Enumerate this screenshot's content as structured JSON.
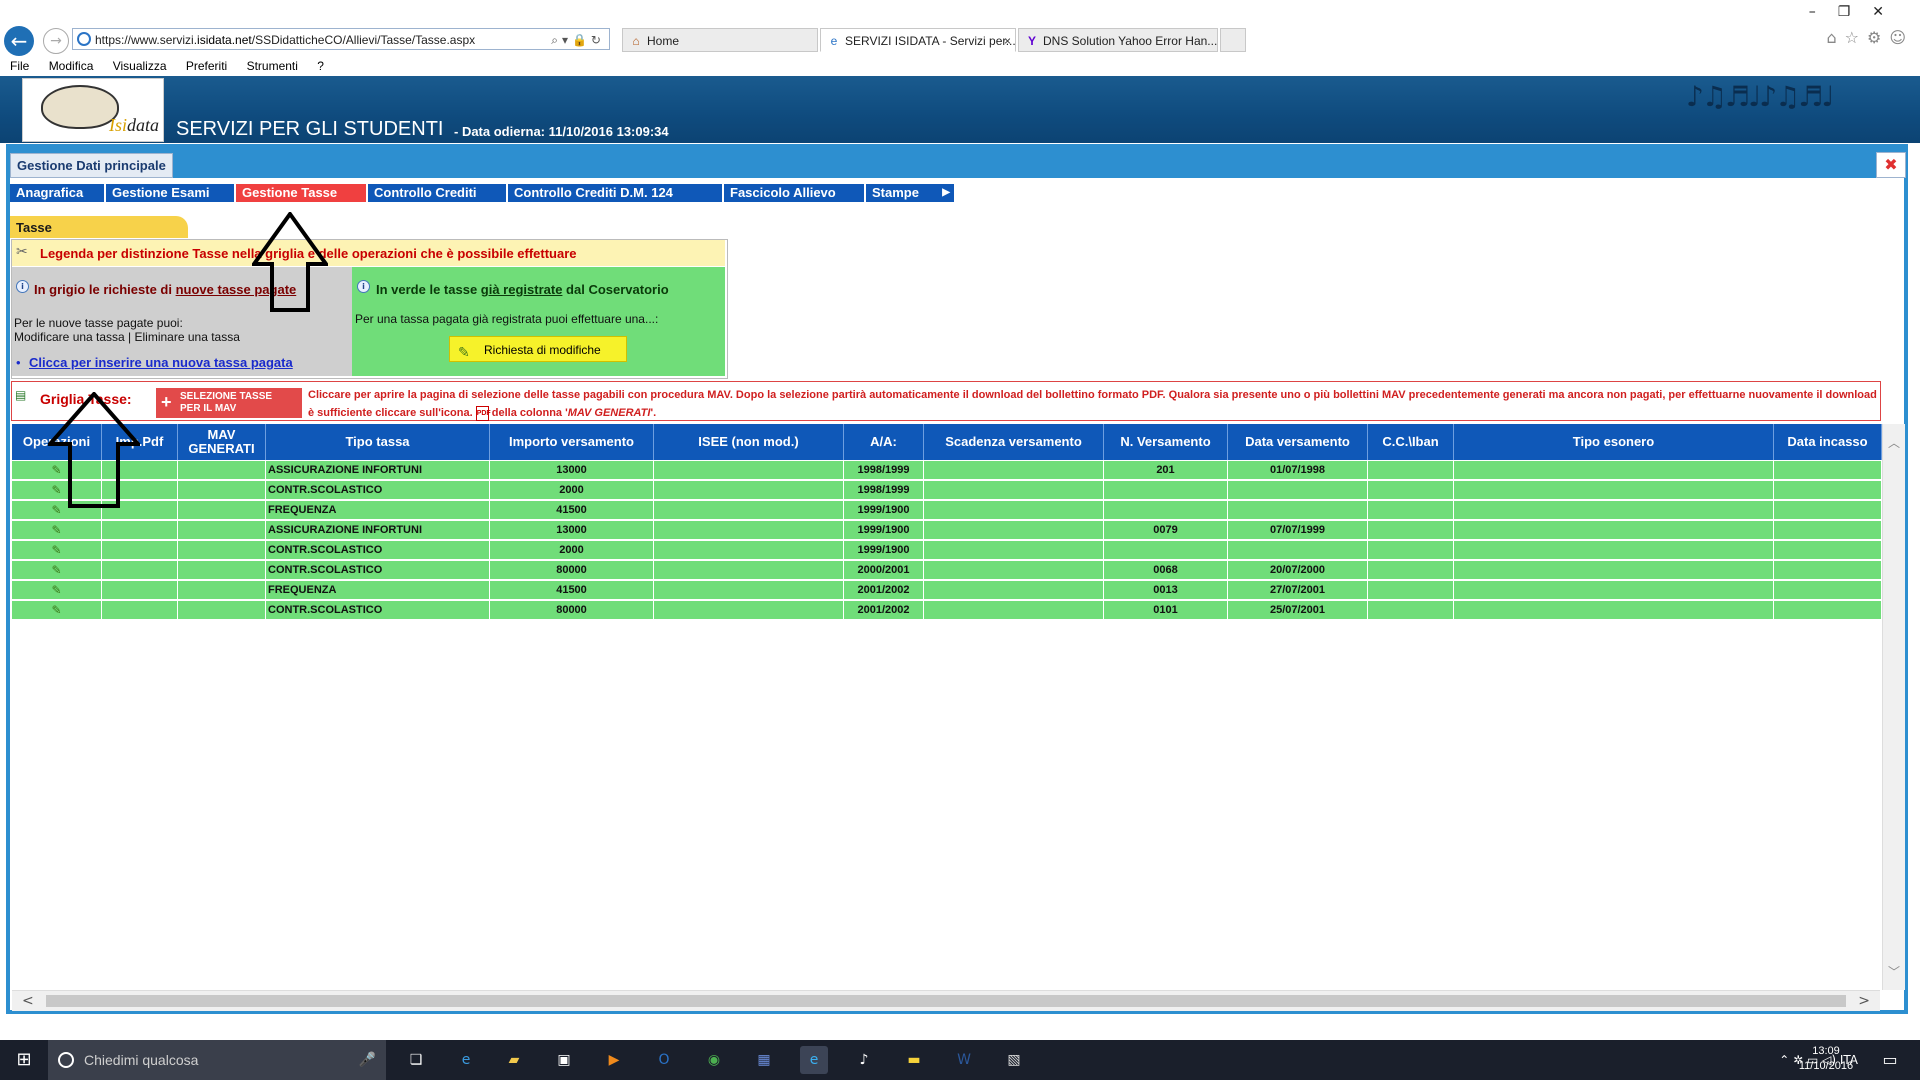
{
  "browser": {
    "url_prefix": "https://www.servizi.",
    "url_domain": "isidata.net",
    "url_path": "/SSDidatticheCO/Allievi/Tasse/Tasse.aspx",
    "address_tools": "⌕▾🔒↻",
    "tabs": [
      {
        "label": "Home",
        "icon": "home-icon"
      },
      {
        "label": "SERVIZI ISIDATA - Servizi per...",
        "icon": "ie-page-icon",
        "close": "×"
      },
      {
        "label": "DNS Solution Yahoo Error Han...",
        "icon": "yahoo-icon"
      }
    ],
    "window_controls": "–❐✕",
    "toolbar_icons": "⌂☆⚙☺",
    "menu": [
      "File",
      "Modifica",
      "Visualizza",
      "Preferiti",
      "Strumenti",
      "?"
    ]
  },
  "header": {
    "logo_text_a": "Isi",
    "logo_text_b": "data",
    "title": "SERVIZI PER GLI STUDENTI",
    "date": "- Data odierna: 11/10/2016 13:09:34",
    "decor": "♪♫♬♩♪♫♬♩"
  },
  "panel": {
    "tab_label": "Gestione Dati principale",
    "close": "✖"
  },
  "nav": [
    {
      "label": "Anagrafica"
    },
    {
      "label": "Gestione Esami"
    },
    {
      "label": "Gestione Tasse"
    },
    {
      "label": "Controllo Crediti"
    },
    {
      "label": "Controllo Crediti D.M. 124"
    },
    {
      "label": "Fascicolo Allievo"
    },
    {
      "label": "Stampe"
    }
  ],
  "section_tab": "Tasse",
  "legend": {
    "title": "Legenda per distinzione Tasse nella griglia e delle operazioni che è possibile effettuare",
    "grey_label_a": "In grigio le richieste di ",
    "grey_label_b": "nuove tasse pagate",
    "grey_text_1": "Per le nuove tasse pagate puoi:",
    "grey_text_2": "Modificare una tassa | Eliminare una tassa",
    "link": "Clicca per inserire una nuova tassa pagata",
    "green_label_a": "In verde le tasse ",
    "green_label_b": "già registrate",
    "green_label_c": " dal Coservatorio",
    "green_text": "Per una tassa pagata già registrata puoi effettuare una...:",
    "modify_button": "Richiesta di modifiche"
  },
  "grid": {
    "title": "Griglia Tasse:",
    "mav_button_1": "SELEZIONE TASSE",
    "mav_button_2": "PER IL MAV",
    "note_a": "Cliccare per aprire la pagina di selezione delle tasse pagabili con procedura MAV. Dopo la selezione partirà automaticamente il download del bollettino formato PDF. Qualora sia presente uno o più bollettini MAV precedentemente generati ma ancora non pagati, per effettuarne nuovamente il download è sufficiente cliccare sull'icona.",
    "note_b": " della colonna '",
    "note_c": "MAV GENERATI",
    "note_d": "'."
  },
  "table": {
    "columns": [
      "Operazioni",
      "Imp.Pdf",
      "MAV GENERATI",
      "Tipo tassa",
      "Importo versamento",
      "ISEE (non mod.)",
      "A/A:",
      "Scadenza versamento",
      "N. Versamento",
      "Data versamento",
      "C.C.\\Iban",
      "Tipo esonero",
      "Data incasso"
    ],
    "rows": [
      [
        "",
        "",
        "",
        "ASSICURAZIONE INFORTUNI",
        "13000",
        "",
        "1998/1999",
        "",
        "201",
        "01/07/1998",
        "",
        "",
        ""
      ],
      [
        "",
        "",
        "",
        "CONTR.SCOLASTICO",
        "2000",
        "",
        "1998/1999",
        "",
        "",
        "",
        "",
        "",
        ""
      ],
      [
        "",
        "",
        "",
        "FREQUENZA",
        "41500",
        "",
        "1999/1900",
        "",
        "",
        "",
        "",
        "",
        ""
      ],
      [
        "",
        "",
        "",
        "ASSICURAZIONE INFORTUNI",
        "13000",
        "",
        "1999/1900",
        "",
        "0079",
        "07/07/1999",
        "",
        "",
        ""
      ],
      [
        "",
        "",
        "",
        "CONTR.SCOLASTICO",
        "2000",
        "",
        "1999/1900",
        "",
        "",
        "",
        "",
        "",
        ""
      ],
      [
        "",
        "",
        "",
        "CONTR.SCOLASTICO",
        "80000",
        "",
        "2000/2001",
        "",
        "0068",
        "20/07/2000",
        "",
        "",
        ""
      ],
      [
        "",
        "",
        "",
        "FREQUENZA",
        "41500",
        "",
        "2001/2002",
        "",
        "0013",
        "27/07/2001",
        "",
        "",
        ""
      ],
      [
        "",
        "",
        "",
        "CONTR.SCOLASTICO",
        "80000",
        "",
        "2001/2002",
        "",
        "0101",
        "25/07/2001",
        "",
        "",
        ""
      ]
    ]
  },
  "taskbar": {
    "search_placeholder": "Chiedimi qualcosa",
    "tray_text": "⌃ ✲ ▭ ◁) ITA",
    "time": "13:09",
    "date": "11/10/2016",
    "apps": [
      "task-view-icon",
      "edge-icon",
      "file-explorer-icon",
      "store-icon",
      "media-icon",
      "outlook-icon",
      "chrome-icon",
      "app-icon",
      "internet-explorer-icon",
      "music-app-icon",
      "sticky-app-icon",
      "word-icon",
      "image-app-icon"
    ]
  },
  "colors": {
    "nav_blue": "#0f58b8",
    "nav_active": "#f04040",
    "grid_green": "#70dd79",
    "legend_grey": "#cfcfcf",
    "accent_red": "#c80000"
  }
}
